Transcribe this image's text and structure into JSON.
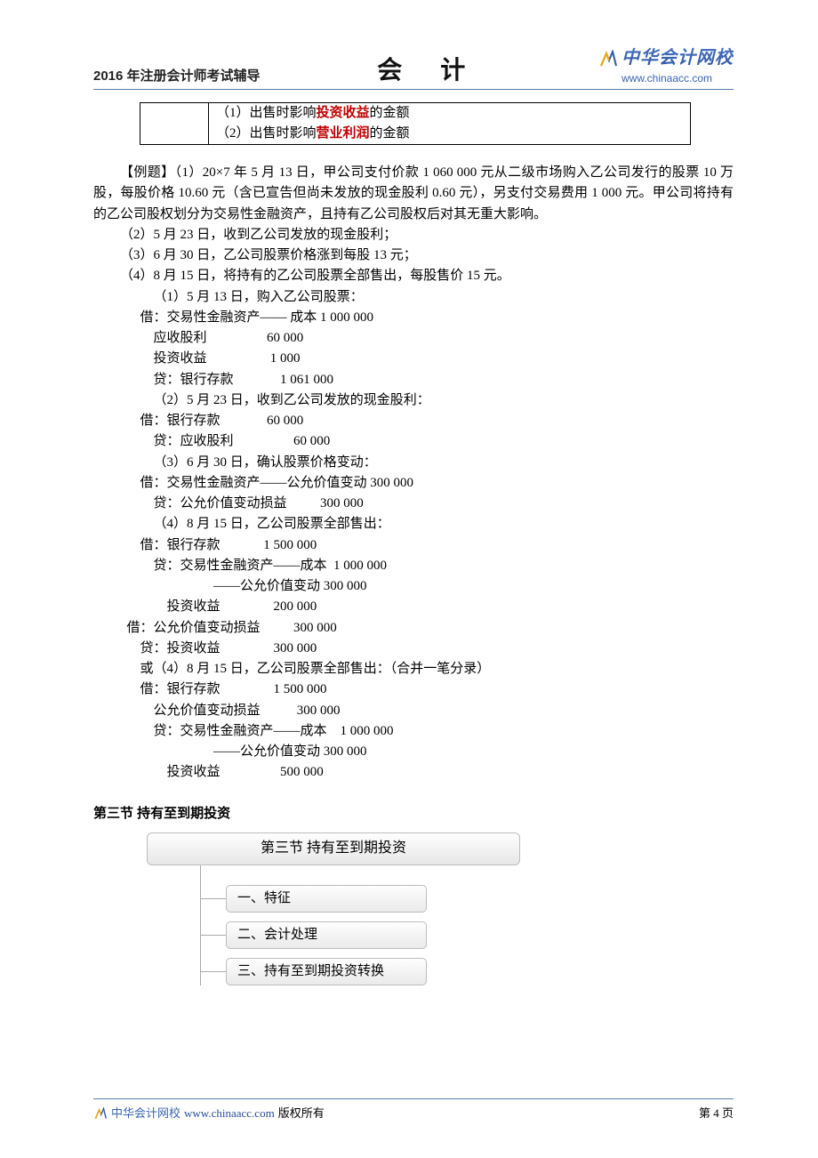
{
  "header": {
    "left": "2016 年注册会计师考试辅导",
    "center": "会  计",
    "brand": "中华会计网校",
    "url": "www.chinaacc.com"
  },
  "top_table": {
    "col1": "",
    "line1_pre": "（1）出售时影响",
    "line1_red": "投资收益",
    "line1_post": "的金额",
    "line2_pre": "（2）出售时影响",
    "line2_red": "营业利润",
    "line2_post": "的金额"
  },
  "example": {
    "label": "【例题】",
    "p1": "（1）20×7 年 5 月 13 日，甲公司支付价款 1 060 000 元从二级市场购入乙公司发行的股票 10 万股，每股价格 10.60 元（含已宣告但尚未发放的现金股利 0.60 元），另支付交易费用 1 000 元。甲公司将持有的乙公司股权划分为交易性金融资产，且持有乙公司股权后对其无重大影响。",
    "p2": "（2）5 月 23 日，收到乙公司发放的现金股利；",
    "p3": "（3）6 月 30 日，乙公司股票价格涨到每股 13 元；",
    "p4": "（4）8 月 15 日，将持有的乙公司股票全部售出，每股售价 15 元。"
  },
  "entries": {
    "e1_title": "（1）5 月 13 日，购入乙公司股票：",
    "e1_l1": "借：交易性金融资产—— 成本 1 000 000",
    "e1_l2": "    应收股利                  60 000",
    "e1_l3": "    投资收益                   1 000",
    "e1_l4": "    贷：银行存款              1 061 000",
    "e2_title": "（2）5 月 23 日，收到乙公司发放的现金股利：",
    "e2_l1": "借：银行存款              60 000",
    "e2_l2": "    贷：应收股利                  60 000",
    "e3_title": "（3）6 月 30 日，确认股票价格变动：",
    "e3_l1": "借：交易性金融资产——公允价值变动 300 000",
    "e3_l2": "    贷：公允价值变动损益          300 000",
    "e4_title": "（4）8 月 15 日，乙公司股票全部售出：",
    "e4_l1": "借：银行存款             1 500 000",
    "e4_l2": "    贷：交易性金融资产——成本  1 000 000",
    "e4_l3": "                      ——公允价值变动 300 000",
    "e4_l4": "        投资收益                200 000",
    "e4_l5a": "借：公允价值变动损益          300 000",
    "e4_l5b": "    贷：投资收益                300 000",
    "e4alt_title": "或（4）8 月 15 日，乙公司股票全部售出：（合并一笔分录）",
    "e4alt_l1": "借：银行存款                1 500 000",
    "e4alt_l2": "    公允价值变动损益           300 000",
    "e4alt_l3": "    贷：交易性金融资产——成本    1 000 000",
    "e4alt_l4": "                      ——公允价值变动 300 000",
    "e4alt_l5": "        投资收益                  500 000"
  },
  "section3": {
    "heading": "第三节  持有至到期投资",
    "outline_title": "第三节  持有至到期投资",
    "item1": "一、特征",
    "item2": "二、会计处理",
    "item3": "三、持有至到期投资转换"
  },
  "footer": {
    "brand": "中华会计网校",
    "url": "www.chinaacc.com",
    "copy": "版权所有",
    "page": "第 4 页"
  }
}
